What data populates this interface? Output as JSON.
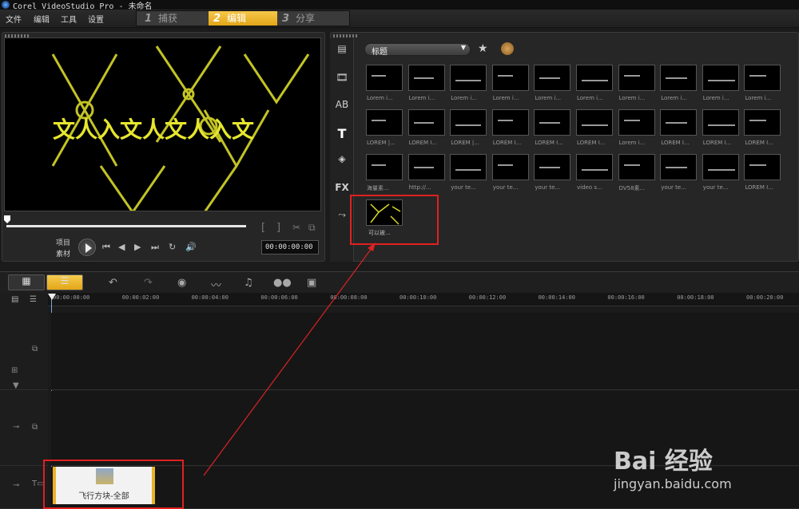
{
  "window": {
    "title": "Corel VideoStudio Pro - 未命名"
  },
  "menu": {
    "file": "文件",
    "edit": "编辑",
    "tools": "工具",
    "settings": "设置"
  },
  "steps": [
    {
      "num": "1",
      "label": "捕获"
    },
    {
      "num": "2",
      "label": "编辑"
    },
    {
      "num": "3",
      "label": "分享"
    }
  ],
  "preview": {
    "mode_project": "项目",
    "mode_clip": "素材",
    "timecode": "00:00:00:00",
    "mark_in": "[",
    "mark_out": "]",
    "overlay_text": "文人入文人文人入文"
  },
  "library": {
    "category": "标题",
    "thumbnails_row1": [
      "Lorem i...",
      "Lorem i...",
      "Lorem i...",
      "Lorem i...",
      "Lorem i...",
      "Lorem i...",
      "Lorem i...",
      "Lorem i...",
      "Lorem i...",
      "Lorem i..."
    ],
    "thumbnails_row2": [
      "LOREM |...",
      "LOREM I...",
      "LOREM |...",
      "LOREM I...",
      "LOREM I...",
      "LOREM I...",
      "Lorem i...",
      "LOREM I...",
      "LOREM I...",
      "LOREM I..."
    ],
    "thumbnails_row3": [
      "海量素...",
      "http://...",
      "your te...",
      "your te...",
      "your te...",
      "video s...",
      "DV58素...",
      "your te...",
      "your te...",
      "LOREM I..."
    ],
    "highlighted_item": "可以被..."
  },
  "timeline": {
    "ticks": [
      "00:00:00:00",
      "00:00:02:00",
      "00:00:04:00",
      "00:00:06:00",
      "00:00:08:00",
      "00:00:10:00",
      "00:00:12:00",
      "00:00:14:00",
      "00:00:16:00",
      "00:00:18:00",
      "00:00:20:00"
    ],
    "title_clip": "飞行方块-全部"
  },
  "watermark": {
    "brand": "Bai 经验",
    "url": "jingyan.baidu.com"
  }
}
